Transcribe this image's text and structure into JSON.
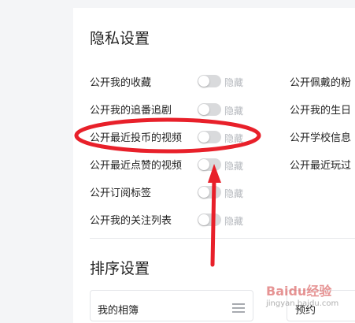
{
  "privacy": {
    "title": "隐私设置",
    "left_items": [
      {
        "label": "公开我的收藏",
        "toggle_text": "隐藏",
        "enabled": false
      },
      {
        "label": "公开我的追番追剧",
        "toggle_text": "隐藏",
        "enabled": false
      },
      {
        "label": "公开最近投币的视频",
        "toggle_text": "隐藏",
        "enabled": false
      },
      {
        "label": "公开最近点赞的视频",
        "toggle_text": "隐藏",
        "enabled": false
      },
      {
        "label": "公开订阅标签",
        "toggle_text": "隐藏",
        "enabled": false
      },
      {
        "label": "公开我的关注列表",
        "toggle_text": "隐藏",
        "enabled": false
      }
    ],
    "right_items": [
      {
        "label": "公开佩戴的粉"
      },
      {
        "label": "公开我的生日"
      },
      {
        "label": "公开学校信息"
      },
      {
        "label": "公开最近玩过"
      }
    ]
  },
  "sort": {
    "title": "排序设置",
    "items": [
      {
        "label": "我的相簿"
      },
      {
        "label": "预约"
      }
    ]
  },
  "annotation_colors": {
    "ellipse": "#e8202a",
    "arrow": "#e8202a"
  },
  "watermark": {
    "text": "Baidu经验",
    "sub": "jingyan.baidu.com"
  }
}
